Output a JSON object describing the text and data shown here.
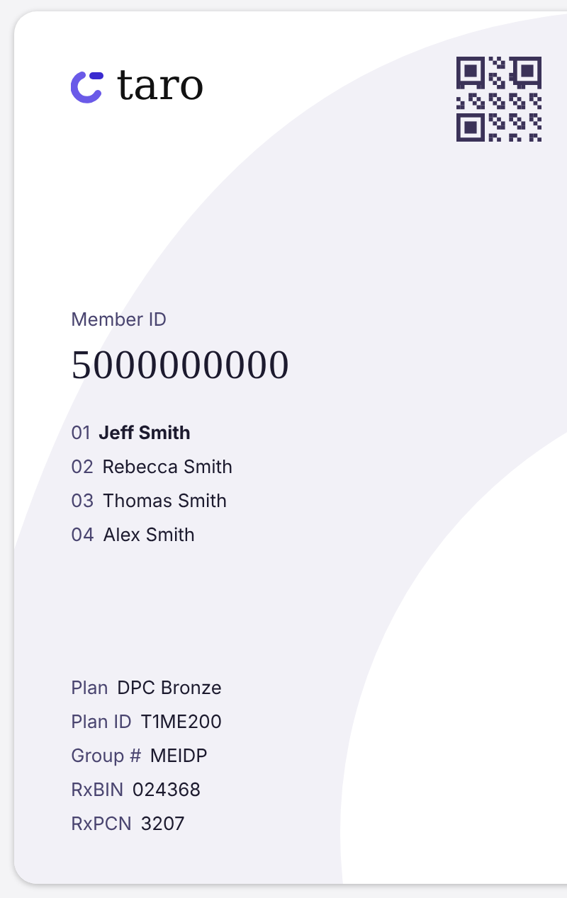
{
  "logo": {
    "text": "taro"
  },
  "member_id": {
    "label": "Member ID",
    "value": "5000000000"
  },
  "members": [
    {
      "number": "01",
      "name": "Jeff Smith",
      "primary": true
    },
    {
      "number": "02",
      "name": "Rebecca Smith",
      "primary": false
    },
    {
      "number": "03",
      "name": "Thomas Smith",
      "primary": false
    },
    {
      "number": "04",
      "name": "Alex Smith",
      "primary": false
    }
  ],
  "plan_details": [
    {
      "label": "Plan",
      "value": "DPC Bronze"
    },
    {
      "label": "Plan ID",
      "value": "T1ME200"
    },
    {
      "label": "Group #",
      "value": "MEIDP"
    },
    {
      "label": "RxBIN",
      "value": "024368"
    },
    {
      "label": "RxPCN",
      "value": "3207"
    }
  ]
}
